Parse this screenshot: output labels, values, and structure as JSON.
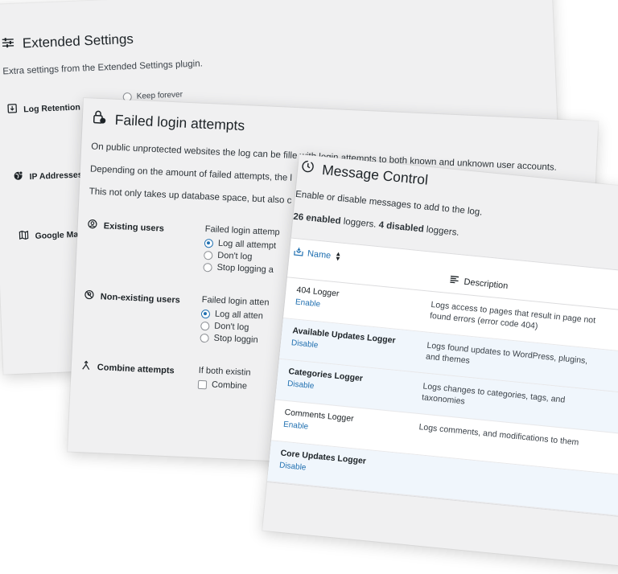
{
  "extended": {
    "title": "Extended Settings",
    "intro": "Extra settings from the Extended Settings plugin.",
    "rows": [
      {
        "label": "Log Retention",
        "icon": "archive-icon"
      },
      {
        "label": "IP Addresses",
        "icon": "globe-icon"
      },
      {
        "label": "Google Maps",
        "icon": "map-icon"
      }
    ],
    "keep_forever": "Keep forever"
  },
  "failed": {
    "title": "Failed login attempts",
    "paragraphs": [
      "On public unprotected websites the log can be fille",
      "Depending on the amount of failed attempts, the l",
      "This not only takes up database space, but also c"
    ],
    "para1_tail": "with login attempts to both known and unknown user accounts.",
    "sections": [
      {
        "label": "Existing users",
        "caption": "Failed login attemp",
        "options": [
          "Log all attempt",
          "Don't log",
          "Stop logging a"
        ],
        "selected": 0
      },
      {
        "label": "Non-existing users",
        "caption": "Failed login atten",
        "options": [
          "Log all atten",
          "Don't log",
          "Stop loggin"
        ],
        "selected": 0
      }
    ],
    "combine": {
      "label": "Combine attempts",
      "caption": "If both existin",
      "checkbox_label": "Combine"
    }
  },
  "message": {
    "title": "Message Control",
    "subtitle": "Enable or disable messages to add to the log.",
    "enabled_count": "26 enabled",
    "loggers_mid": " loggers. ",
    "disabled_count": "4 disabled",
    "loggers_end": " loggers.",
    "col_name": "Name",
    "col_desc": "Description",
    "rows": [
      {
        "name": "404 Logger",
        "action": "Enable",
        "desc": "Logs access to pages that result in page not found errors (error code 404)",
        "active": false
      },
      {
        "name": "Available Updates Logger",
        "action": "Disable",
        "desc": "Logs found updates to WordPress, plugins, and themes",
        "active": true
      },
      {
        "name": "Categories Logger",
        "action": "Disable",
        "desc": "Logs changes to categories, tags, and taxonomies",
        "active": true
      },
      {
        "name": "Comments Logger",
        "action": "Enable",
        "desc": "Logs comments, and modifications to them",
        "active": false
      },
      {
        "name": "Core Updates Logger",
        "action": "Disable",
        "desc": "",
        "active": true
      }
    ]
  }
}
